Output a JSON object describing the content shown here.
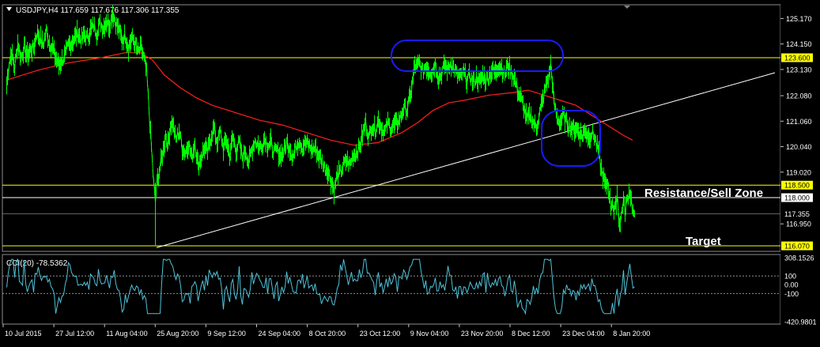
{
  "header": {
    "symbol_line": "USDJPY,H4  117.659 117.676 117.306 117.355",
    "cci_line": "CCI(20) -78.5362"
  },
  "annotations": {
    "resistance": "Resistance/Sell Zone",
    "target": "Target"
  },
  "colors": {
    "background": "#000000",
    "price": "#00ff00",
    "ma": "#ff2020",
    "trendline": "#ffffff",
    "hline_yellow": "#ffff00",
    "hline_white": "#ffffff",
    "ellipse": "#1a1aff",
    "cci": "#4fc3d9"
  },
  "chart_data": [
    {
      "type": "line",
      "title": "USDJPY,H4",
      "ohlc": {
        "open": 117.659,
        "high": 117.676,
        "low": 117.306,
        "close": 117.355
      },
      "xlabel": "",
      "ylabel": "",
      "x_ticks": [
        "10 Jul 2015",
        "27 Jul 12:00",
        "11 Aug 04:00",
        "25 Aug 20:00",
        "9 Sep 12:00",
        "24 Sep 04:00",
        "8 Oct 20:00",
        "23 Oct 12:00",
        "9 Nov 04:00",
        "23 Nov 20:00",
        "8 Dec 12:00",
        "23 Dec 04:00",
        "8 Jan 20:00"
      ],
      "y_ticks": [
        125.17,
        124.15,
        123.13,
        122.08,
        121.06,
        120.04,
        119.02,
        116.95
      ],
      "ylim": [
        115.85,
        125.72
      ],
      "grid": false,
      "price_series_approx": [
        [
          0,
          122.5
        ],
        [
          3,
          123.4
        ],
        [
          6,
          123.8
        ],
        [
          10,
          123.2
        ],
        [
          14,
          124.2
        ],
        [
          18,
          123.6
        ],
        [
          22,
          124.0
        ],
        [
          26,
          123.7
        ],
        [
          30,
          123.9
        ],
        [
          34,
          124.0
        ],
        [
          38,
          124.6
        ],
        [
          42,
          124.4
        ],
        [
          46,
          124.1
        ],
        [
          50,
          124.7
        ],
        [
          54,
          124.2
        ],
        [
          58,
          124.0
        ],
        [
          62,
          123.6
        ],
        [
          66,
          123.3
        ],
        [
          70,
          123.5
        ],
        [
          74,
          123.7
        ],
        [
          78,
          124.1
        ],
        [
          82,
          124.2
        ],
        [
          86,
          124.4
        ],
        [
          90,
          124.6
        ],
        [
          94,
          124.3
        ],
        [
          98,
          124.5
        ],
        [
          102,
          124.4
        ],
        [
          106,
          124.7
        ],
        [
          110,
          124.9
        ],
        [
          114,
          124.6
        ],
        [
          118,
          125.0
        ],
        [
          122,
          124.8
        ],
        [
          126,
          125.1
        ],
        [
          130,
          124.9
        ],
        [
          134,
          125.4
        ],
        [
          138,
          125.0
        ],
        [
          142,
          124.7
        ],
        [
          146,
          124.3
        ],
        [
          150,
          124.5
        ],
        [
          154,
          124.0
        ],
        [
          158,
          124.4
        ],
        [
          162,
          124.2
        ],
        [
          166,
          123.8
        ],
        [
          170,
          124.0
        ],
        [
          174,
          123.5
        ],
        [
          177,
          123.0
        ],
        [
          180,
          121.5
        ],
        [
          183,
          120.0
        ],
        [
          186,
          118.5
        ],
        [
          188,
          117.8
        ],
        [
          190,
          118.6
        ],
        [
          192,
          118.9
        ],
        [
          195,
          119.4
        ],
        [
          198,
          119.9
        ],
        [
          201,
          120.5
        ],
        [
          204,
          120.1
        ],
        [
          207,
          120.9
        ],
        [
          210,
          121.0
        ],
        [
          214,
          120.3
        ],
        [
          218,
          120.7
        ],
        [
          222,
          120.0
        ],
        [
          226,
          119.8
        ],
        [
          230,
          120.2
        ],
        [
          234,
          119.6
        ],
        [
          238,
          120.2
        ],
        [
          242,
          119.3
        ],
        [
          246,
          119.6
        ],
        [
          250,
          120.0
        ],
        [
          254,
          119.8
        ],
        [
          258,
          120.4
        ],
        [
          262,
          120.8
        ],
        [
          266,
          120.2
        ],
        [
          270,
          120.6
        ],
        [
          274,
          120.0
        ],
        [
          278,
          120.3
        ],
        [
          282,
          119.7
        ],
        [
          286,
          120.4
        ],
        [
          290,
          119.9
        ],
        [
          294,
          120.2
        ],
        [
          298,
          119.6
        ],
        [
          302,
          119.9
        ],
        [
          306,
          119.4
        ],
        [
          310,
          119.9
        ],
        [
          314,
          120.3
        ],
        [
          318,
          120.1
        ],
        [
          322,
          120.0
        ],
        [
          326,
          120.4
        ],
        [
          330,
          120.1
        ],
        [
          334,
          120.2
        ],
        [
          338,
          119.8
        ],
        [
          342,
          119.9
        ],
        [
          346,
          119.7
        ],
        [
          350,
          119.8
        ],
        [
          354,
          120.2
        ],
        [
          358,
          120.0
        ],
        [
          362,
          119.6
        ],
        [
          366,
          120.1
        ],
        [
          370,
          120.3
        ],
        [
          374,
          120.0
        ],
        [
          378,
          120.2
        ],
        [
          382,
          120.1
        ],
        [
          386,
          119.9
        ],
        [
          390,
          120.0
        ],
        [
          394,
          119.7
        ],
        [
          398,
          119.5
        ],
        [
          402,
          119.2
        ],
        [
          406,
          119.1
        ],
        [
          410,
          118.7
        ],
        [
          414,
          118.3
        ],
        [
          418,
          118.9
        ],
        [
          422,
          119.0
        ],
        [
          426,
          119.3
        ],
        [
          430,
          119.5
        ],
        [
          434,
          119.3
        ],
        [
          438,
          119.7
        ],
        [
          442,
          119.8
        ],
        [
          446,
          120.0
        ],
        [
          450,
          120.5
        ],
        [
          454,
          121.0
        ],
        [
          458,
          120.4
        ],
        [
          462,
          120.9
        ],
        [
          466,
          120.7
        ],
        [
          470,
          121.1
        ],
        [
          474,
          120.8
        ],
        [
          478,
          120.6
        ],
        [
          482,
          121.0
        ],
        [
          486,
          120.8
        ],
        [
          490,
          120.9
        ],
        [
          494,
          121.0
        ],
        [
          498,
          121.2
        ],
        [
          502,
          121.6
        ],
        [
          506,
          121.5
        ],
        [
          510,
          122.0
        ],
        [
          514,
          122.8
        ],
        [
          516,
          123.3
        ],
        [
          518,
          123.2
        ],
        [
          522,
          123.4
        ],
        [
          526,
          123.0
        ],
        [
          530,
          123.3
        ],
        [
          534,
          123.1
        ],
        [
          538,
          123.0
        ],
        [
          542,
          123.4
        ],
        [
          546,
          122.8
        ],
        [
          550,
          123.0
        ],
        [
          554,
          123.3
        ],
        [
          558,
          123.1
        ],
        [
          562,
          123.4
        ],
        [
          566,
          123.1
        ],
        [
          570,
          122.9
        ],
        [
          574,
          122.8
        ],
        [
          578,
          123.0
        ],
        [
          582,
          122.7
        ],
        [
          586,
          122.9
        ],
        [
          590,
          122.6
        ],
        [
          594,
          122.8
        ],
        [
          598,
          122.6
        ],
        [
          602,
          122.9
        ],
        [
          606,
          122.7
        ],
        [
          610,
          122.9
        ],
        [
          614,
          123.1
        ],
        [
          618,
          123.0
        ],
        [
          622,
          123.3
        ],
        [
          626,
          123.2
        ],
        [
          630,
          122.9
        ],
        [
          634,
          123.3
        ],
        [
          638,
          123.0
        ],
        [
          642,
          122.8
        ],
        [
          646,
          122.3
        ],
        [
          650,
          122.0
        ],
        [
          654,
          121.6
        ],
        [
          658,
          121.1
        ],
        [
          662,
          121.3
        ],
        [
          666,
          121.0
        ],
        [
          670,
          120.8
        ],
        [
          674,
          121.4
        ],
        [
          678,
          121.9
        ],
        [
          682,
          122.5
        ],
        [
          686,
          122.9
        ],
        [
          688,
          123.3
        ],
        [
          690,
          122.7
        ],
        [
          692,
          121.8
        ],
        [
          694,
          121.5
        ],
        [
          696,
          121.2
        ],
        [
          700,
          121.0
        ],
        [
          704,
          121.3
        ],
        [
          708,
          121.0
        ],
        [
          712,
          120.9
        ],
        [
          716,
          120.7
        ],
        [
          720,
          120.8
        ],
        [
          724,
          120.6
        ],
        [
          728,
          120.5
        ],
        [
          732,
          120.7
        ],
        [
          736,
          120.4
        ],
        [
          740,
          120.6
        ],
        [
          744,
          120.4
        ],
        [
          746,
          120.1
        ],
        [
          748,
          119.9
        ],
        [
          750,
          119.5
        ],
        [
          752,
          119.1
        ],
        [
          754,
          118.9
        ],
        [
          756,
          118.6
        ],
        [
          758,
          118.4
        ],
        [
          760,
          118.6
        ],
        [
          762,
          118.2
        ],
        [
          764,
          117.6
        ],
        [
          766,
          117.9
        ],
        [
          768,
          117.4
        ],
        [
          770,
          117.6
        ],
        [
          772,
          118.2
        ],
        [
          774,
          117.2
        ],
        [
          776,
          116.95
        ],
        [
          778,
          117.5
        ],
        [
          780,
          117.9
        ],
        [
          782,
          117.4
        ],
        [
          784,
          117.8
        ],
        [
          786,
          118.1
        ],
        [
          788,
          118.3
        ],
        [
          790,
          117.9
        ],
        [
          792,
          117.4
        ],
        [
          794,
          117.355
        ]
      ],
      "ma_series_approx": [
        [
          0,
          122.7
        ],
        [
          40,
          123.1
        ],
        [
          80,
          123.4
        ],
        [
          120,
          123.6
        ],
        [
          150,
          123.8
        ],
        [
          170,
          123.8
        ],
        [
          185,
          123.5
        ],
        [
          200,
          122.9
        ],
        [
          220,
          122.4
        ],
        [
          240,
          122.0
        ],
        [
          260,
          121.7
        ],
        [
          290,
          121.4
        ],
        [
          320,
          121.1
        ],
        [
          350,
          120.9
        ],
        [
          380,
          120.6
        ],
        [
          410,
          120.3
        ],
        [
          440,
          120.1
        ],
        [
          470,
          120.2
        ],
        [
          500,
          120.6
        ],
        [
          520,
          121.0
        ],
        [
          540,
          121.5
        ],
        [
          560,
          121.8
        ],
        [
          580,
          121.9
        ],
        [
          610,
          122.1
        ],
        [
          640,
          122.2
        ],
        [
          660,
          122.3
        ],
        [
          680,
          122.1
        ],
        [
          700,
          121.9
        ],
        [
          720,
          121.7
        ],
        [
          740,
          121.3
        ],
        [
          760,
          120.9
        ],
        [
          780,
          120.5
        ],
        [
          792,
          120.3
        ]
      ],
      "horizontal_levels": [
        {
          "value": 123.6,
          "label": "123.600",
          "color": "yellow"
        },
        {
          "value": 118.5,
          "label": "118.500",
          "color": "yellow"
        },
        {
          "value": 118.0,
          "label": "118.000",
          "color": "white"
        },
        {
          "value": 117.355,
          "label": "117.355",
          "color": "current"
        },
        {
          "value": 116.07,
          "label": "116.070",
          "color": "yellow"
        }
      ],
      "trendline": {
        "from": [
          190,
          116.0
        ],
        "to": [
          972,
          123.0
        ]
      },
      "annotations": [
        "Resistance/Sell Zone",
        "Target"
      ]
    },
    {
      "type": "line",
      "title": "CCI(20)",
      "value": -78.5362,
      "y_ticks": [
        308.1526,
        100,
        0.0,
        -100,
        -420.9801
      ],
      "y_tick_labels": [
        "308.1526",
        "100",
        "0.00",
        "-100",
        "-420.9801"
      ],
      "ylim": [
        -450,
        345
      ],
      "levels": [
        100,
        -100
      ],
      "grid": false
    }
  ]
}
